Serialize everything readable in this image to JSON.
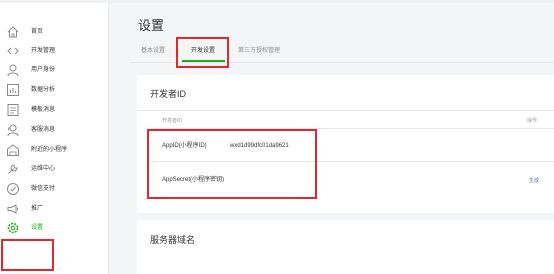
{
  "sidebar": {
    "items": [
      {
        "label": "首页",
        "icon": "home-icon"
      },
      {
        "label": "开发管理",
        "icon": "code-icon"
      },
      {
        "label": "用户身份",
        "icon": "user-icon"
      },
      {
        "label": "数据分析",
        "icon": "chart-icon"
      },
      {
        "label": "模板消息",
        "icon": "template-icon"
      },
      {
        "label": "客服消息",
        "icon": "service-icon"
      },
      {
        "label": "附近的小程序",
        "icon": "location-icon"
      },
      {
        "label": "运维中心",
        "icon": "wrench-icon"
      },
      {
        "label": "微信支付",
        "icon": "payment-icon"
      },
      {
        "label": "推广",
        "icon": "megaphone-icon"
      },
      {
        "label": "设置",
        "icon": "settings-icon",
        "active": true
      }
    ]
  },
  "page": {
    "title": "设置",
    "tabs": [
      "基本设置",
      "开发设置",
      "第三方授权管理"
    ],
    "active_tab": "开发设置"
  },
  "developer_id": {
    "title": "开发者ID",
    "column_id": "开发者ID",
    "column_action": "操作",
    "rows": [
      {
        "label": "AppID(小程序ID)",
        "value": "wxd1d99dfc01da9621",
        "action": ""
      },
      {
        "label": "AppSecret(小程序密钥)",
        "value": "",
        "action": "生成"
      }
    ]
  },
  "server_domain": {
    "title": "服务器域名"
  },
  "colors": {
    "accent": "#1aad19",
    "highlight": "#e0282e",
    "link": "#576b95",
    "background": "#f4f5f7"
  }
}
